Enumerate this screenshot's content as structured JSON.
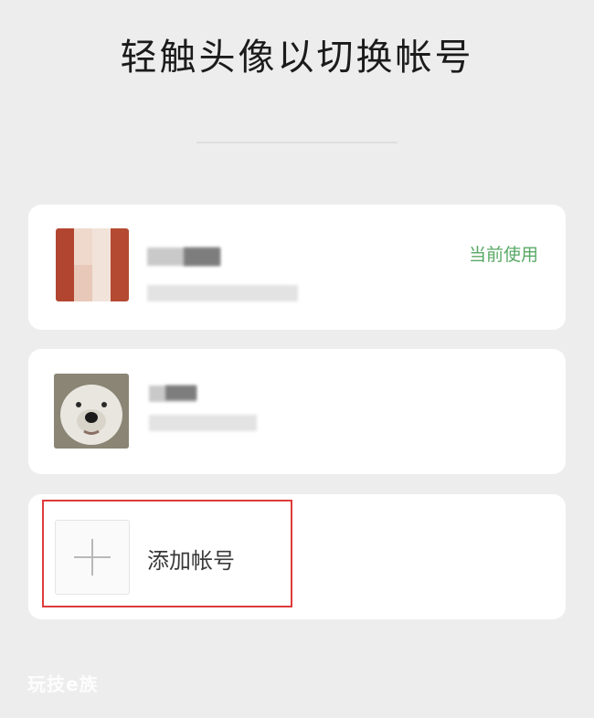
{
  "header": {
    "title": "轻触头像以切换帐号"
  },
  "accounts": [
    {
      "status_label": "当前使用"
    },
    {
      "status_label": ""
    }
  ],
  "add_account": {
    "label": "添加帐号",
    "icon": "plus-icon"
  },
  "watermark": "玩技e族",
  "colors": {
    "background": "#ededed",
    "card": "#ffffff",
    "current_green": "#58a865",
    "highlight_red": "#de3b3b"
  }
}
